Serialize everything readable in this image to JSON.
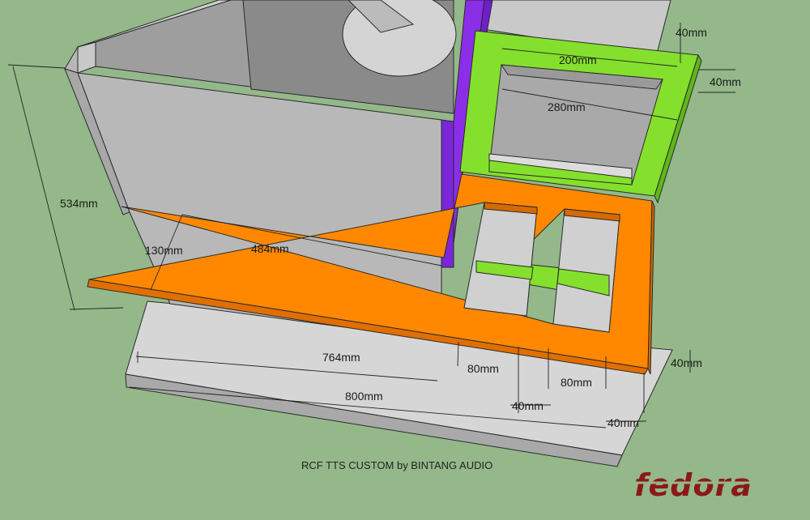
{
  "title": "RCF TTS CUSTOM by BINTANG AUDIO",
  "logo": "fedora",
  "colors": {
    "background": "#94b88a",
    "panel_light": "#d3d3d3",
    "panel_mid": "#b9b9b9",
    "panel_dark": "#8f8f8f",
    "orange": "#ff8800",
    "green": "#84e02c",
    "purple": "#8e33f5",
    "logo": "#8c1818"
  },
  "dimensions": {
    "top_edge": "40mm",
    "top_inner_width": "200mm",
    "top_right_side": "40mm",
    "top_outer_width": "280mm",
    "height": "534mm",
    "strip_depth": "130mm",
    "strip_length": "484mm",
    "right_side": "40mm",
    "inner_length": "764mm",
    "slot_1": "80mm",
    "slot_2": "80mm",
    "mid_gap": "40mm",
    "total_length": "800mm",
    "end_gap": "40mm"
  }
}
